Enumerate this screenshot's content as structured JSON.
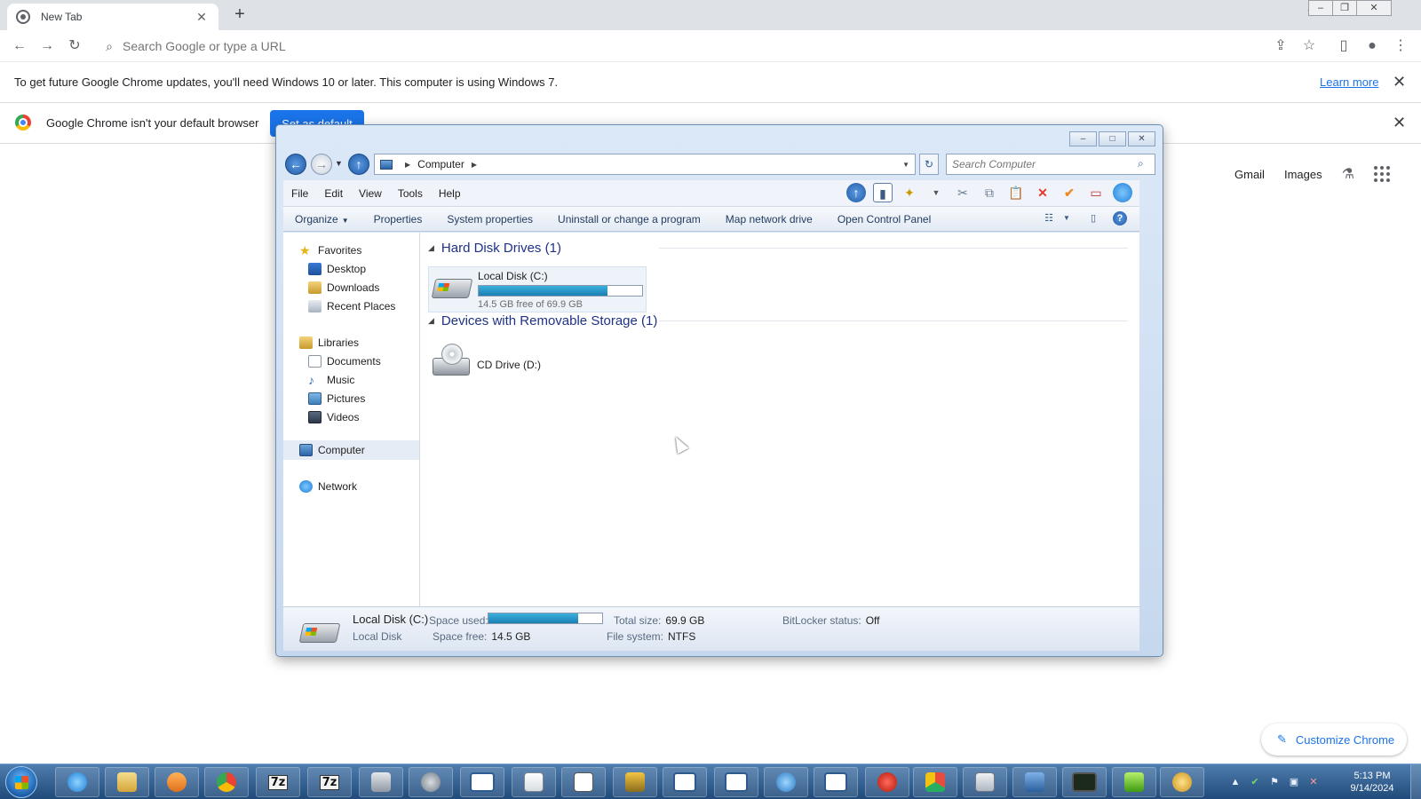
{
  "browser": {
    "tab_title": "New Tab",
    "tab_close": "✕",
    "new_tab": "+",
    "omnibox_placeholder": "Search Google or type a URL",
    "infobar_update": {
      "message": "To get future Google Chrome updates, you'll need Windows 10 or later. This computer is using Windows 7.",
      "link": "Learn more"
    },
    "infobar_default": {
      "message": "Google Chrome isn't your default browser",
      "button": "Set as default"
    },
    "ntp_links": [
      "Gmail",
      "Images"
    ],
    "customize_label": "Customize Chrome"
  },
  "explorer": {
    "address_path": "Computer",
    "search_placeholder": "Search Computer",
    "menu": [
      "File",
      "Edit",
      "View",
      "Tools",
      "Help"
    ],
    "commands": [
      "Organize",
      "Properties",
      "System properties",
      "Uninstall or change a program",
      "Map network drive",
      "Open Control Panel"
    ],
    "nav_pane": {
      "favorites": "Favorites",
      "favorites_items": [
        "Desktop",
        "Downloads",
        "Recent Places"
      ],
      "libraries": "Libraries",
      "libraries_items": [
        "Documents",
        "Music",
        "Pictures",
        "Videos"
      ],
      "computer": "Computer",
      "network": "Network"
    },
    "groups": {
      "hdd_header": "Hard Disk Drives (1)",
      "removable_header": "Devices with Removable Storage (1)"
    },
    "drive_c": {
      "name": "Local Disk (C:)",
      "free_text": "14.5 GB free of 69.9 GB",
      "used_fraction": 0.79
    },
    "drive_d": {
      "name": "CD Drive (D:)"
    },
    "details": {
      "name": "Local Disk (C:)",
      "type": "Local Disk",
      "space_used_label": "Space used:",
      "space_free_label": "Space free:",
      "space_free": "14.5 GB",
      "total_size_label": "Total size:",
      "total_size": "69.9 GB",
      "file_system_label": "File system:",
      "file_system": "NTFS",
      "bitlocker_label": "BitLocker status:",
      "bitlocker": "Off"
    }
  },
  "taskbar": {
    "apps": [
      "start",
      "internet-explorer",
      "windows-explorer",
      "media-player",
      "google-chrome",
      "7zip",
      "7zip",
      "printer",
      "settings",
      "window",
      "new-document",
      "notepad",
      "dice",
      "presentation",
      "presentation",
      "network-tools",
      "presentation",
      "red-app",
      "green-app",
      "calculator",
      "remote-desktop",
      "terminal",
      "green-leaf",
      "search-tool"
    ],
    "time": "5:13 PM",
    "date": "9/14/2024"
  },
  "colors": {
    "chrome_blue": "#1a73e8",
    "explorer_frame": "#c6d8ee",
    "usage_fill": "#1a7fb2",
    "taskbar": "#1f4a7a"
  }
}
